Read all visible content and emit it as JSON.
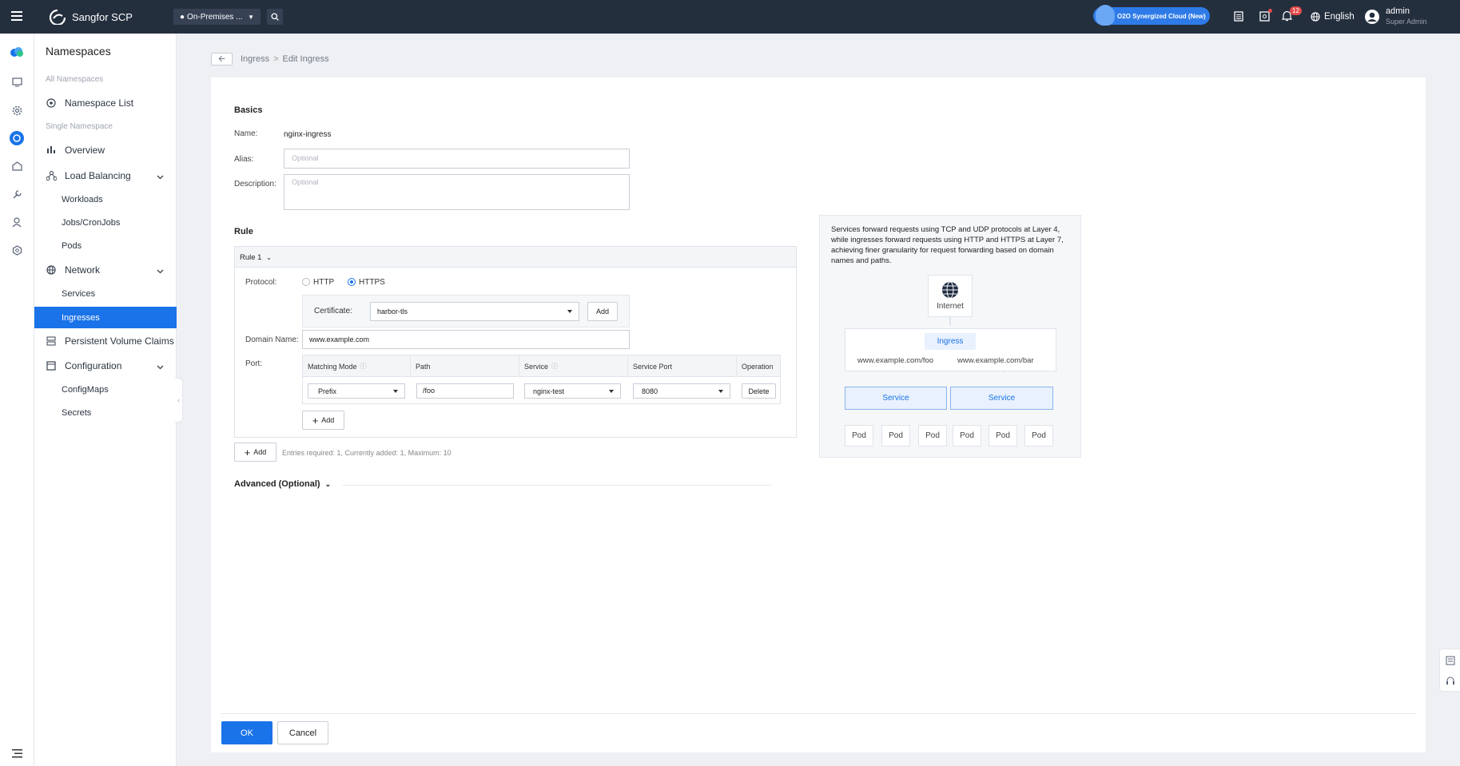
{
  "topbar": {
    "app_name": "Sangfor SCP",
    "location": "On-Premises ...",
    "synergy": "O2O Synergized Cloud (New)",
    "notif_count": "12",
    "language": "English",
    "user": "admin",
    "role": "Super Admin"
  },
  "sidebar": {
    "title": "Namespaces",
    "group_all": "All Namespaces",
    "namespace_list": "Namespace List",
    "group_single": "Single Namespace",
    "overview": "Overview",
    "load_balancing": "Load Balancing",
    "workloads": "Workloads",
    "jobs": "Jobs/CronJobs",
    "pods": "Pods",
    "network": "Network",
    "services": "Services",
    "ingresses": "Ingresses",
    "pvc": "Persistent Volume Claims",
    "configuration": "Configuration",
    "configmaps": "ConfigMaps",
    "secrets": "Secrets"
  },
  "breadcrumb": {
    "parent": "Ingress",
    "sep": ">",
    "current": "Edit Ingress"
  },
  "basics": {
    "title": "Basics",
    "name_label": "Name:",
    "name_value": "nginx-ingress",
    "alias_label": "Alias:",
    "alias_placeholder": "Optional",
    "desc_label": "Description:",
    "desc_placeholder": "Optional"
  },
  "rule": {
    "title": "Rule",
    "rule_tab": "Rule 1",
    "protocol_label": "Protocol:",
    "http": "HTTP",
    "https": "HTTPS",
    "selected_protocol": "HTTPS",
    "cert_label": "Certificate:",
    "cert_value": "harbor-tls",
    "cert_add": "Add",
    "domain_label": "Domain Name:",
    "domain_value": "www.example.com",
    "port_label": "Port:",
    "columns": [
      "Matching Mode",
      "Path",
      "Service",
      "Service Port",
      "Operation"
    ],
    "row": {
      "mode": "Prefix",
      "path": "/foo",
      "service": "nginx-test",
      "port": "8080",
      "op": "Delete"
    },
    "add_port": "Add",
    "add_rule": "Add",
    "entries_note": "Entries required: 1, Currently added: 1, Maximum: 10"
  },
  "advanced": "Advanced (Optional)",
  "diagram": {
    "text": "Services forward requests using TCP and UDP protocols at Layer 4, while ingresses forward requests using HTTP and HTTPS at Layer 7, achieving finer granularity for request forwarding based on domain names and paths.",
    "internet": "Internet",
    "ingress": "Ingress",
    "path_foo": "www.example.com/foo",
    "path_bar": "www.example.com/bar",
    "service": "Service",
    "pod": "Pod"
  },
  "footer": {
    "ok": "OK",
    "cancel": "Cancel"
  },
  "colors": {
    "accent": "#1a73e8",
    "topbar": "#242f3e"
  }
}
